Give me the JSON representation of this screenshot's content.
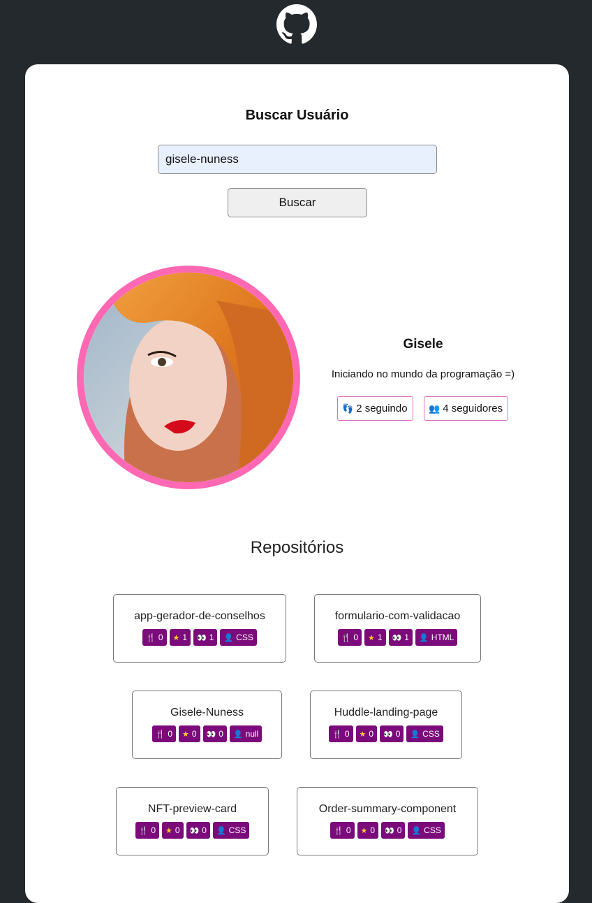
{
  "header": {
    "logo_icon": "github-octocat-icon"
  },
  "search": {
    "title": "Buscar Usuário",
    "input_value": "gisele-nuness",
    "button_label": "Buscar"
  },
  "profile": {
    "name": "Gisele",
    "bio": "Iniciando no mundo da programação =)",
    "following": "2 seguindo",
    "followers": "4 seguidores",
    "accent_color": "#ff69b4"
  },
  "repos": {
    "title": "Repositórios",
    "tag_color": "#7b0a7b",
    "items": [
      {
        "name": "app-gerador-de-conselhos",
        "forks": "0",
        "stars": "1",
        "watchers": "1",
        "language": "CSS"
      },
      {
        "name": "formulario-com-validacao",
        "forks": "0",
        "stars": "1",
        "watchers": "1",
        "language": "HTML"
      },
      {
        "name": "Gisele-Nuness",
        "forks": "0",
        "stars": "0",
        "watchers": "0",
        "language": "null"
      },
      {
        "name": "Huddle-landing-page",
        "forks": "0",
        "stars": "0",
        "watchers": "0",
        "language": "CSS"
      },
      {
        "name": "NFT-preview-card",
        "forks": "0",
        "stars": "0",
        "watchers": "0",
        "language": "CSS"
      },
      {
        "name": "Order-summary-component",
        "forks": "0",
        "stars": "0",
        "watchers": "0",
        "language": "CSS"
      }
    ]
  }
}
